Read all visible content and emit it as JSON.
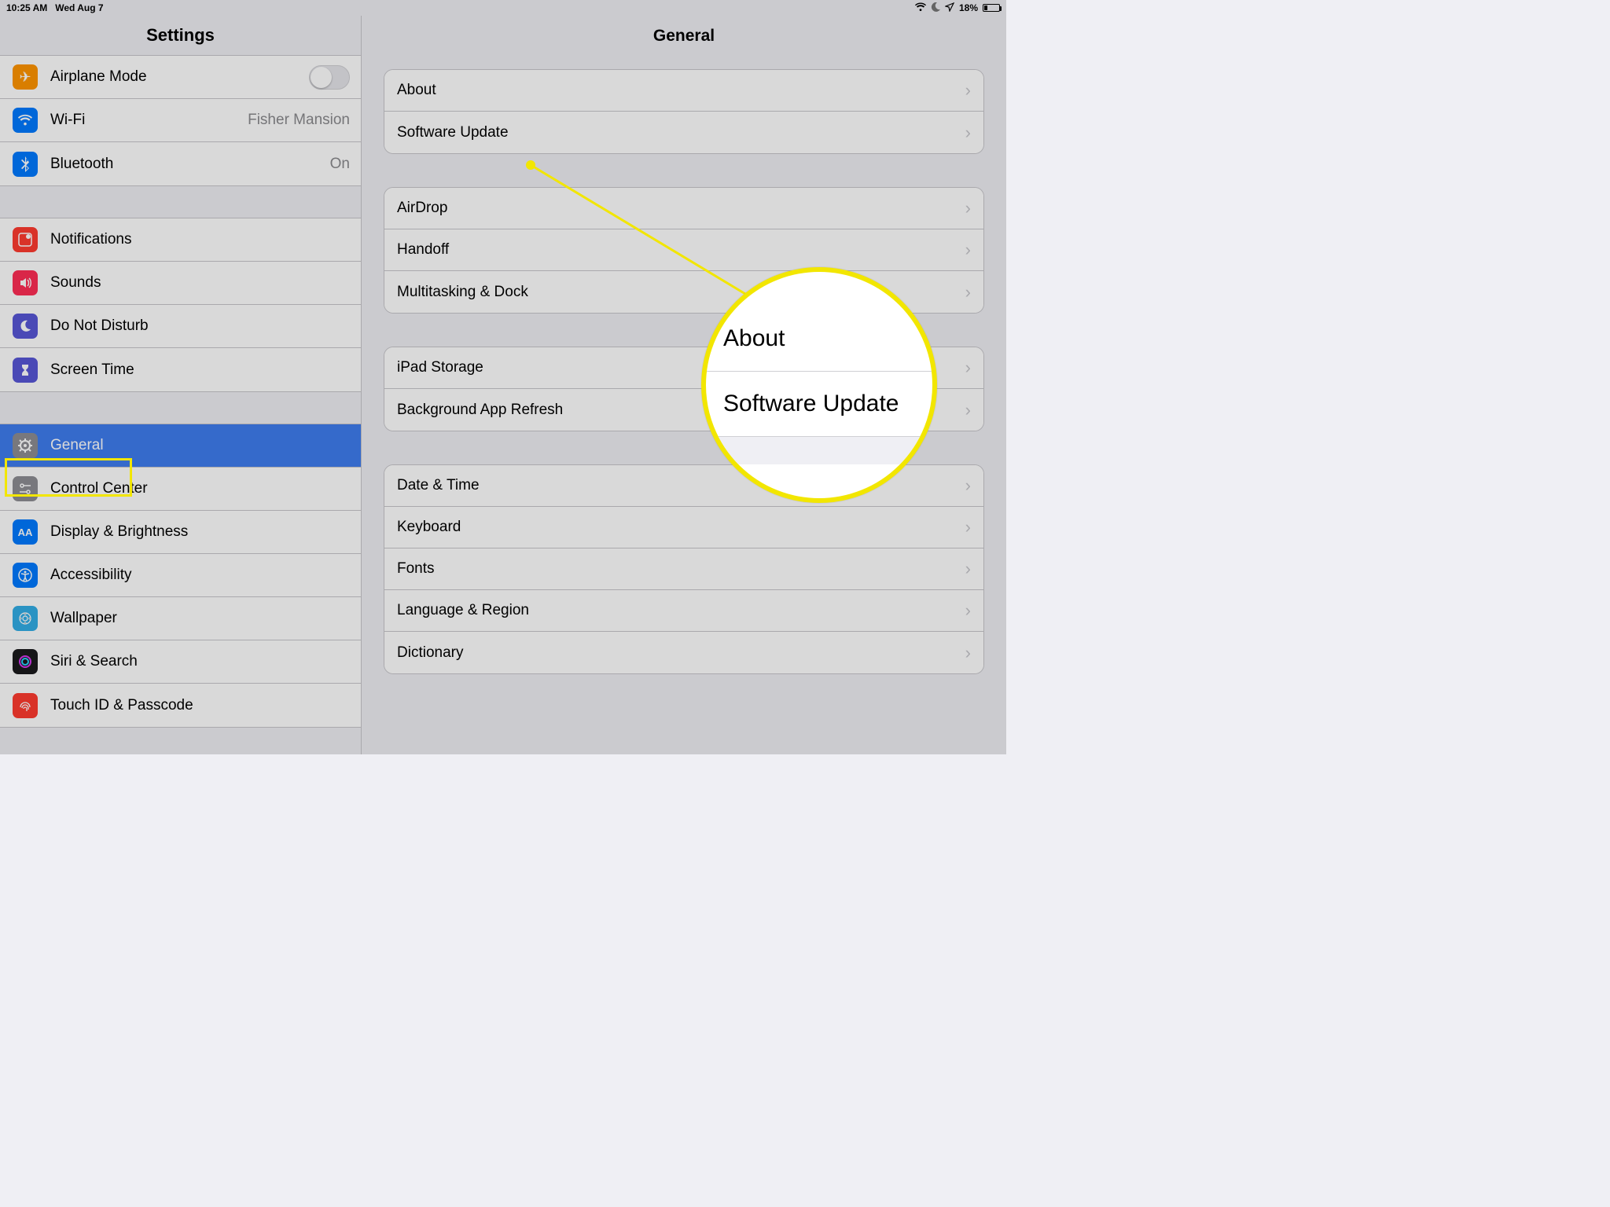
{
  "status": {
    "time": "10:25 AM",
    "date": "Wed Aug 7",
    "battery": "18%"
  },
  "sidebar": {
    "title": "Settings",
    "group1": {
      "airplane": "Airplane Mode",
      "wifi": "Wi-Fi",
      "wifi_value": "Fisher Mansion",
      "bluetooth": "Bluetooth",
      "bluetooth_value": "On"
    },
    "group2": {
      "notifications": "Notifications",
      "sounds": "Sounds",
      "dnd": "Do Not Disturb",
      "screentime": "Screen Time"
    },
    "group3": {
      "general": "General",
      "controlcenter": "Control Center",
      "display": "Display & Brightness",
      "accessibility": "Accessibility",
      "wallpaper": "Wallpaper",
      "siri": "Siri & Search",
      "touchid": "Touch ID & Passcode"
    }
  },
  "detail": {
    "title": "General",
    "g1": {
      "about": "About",
      "software": "Software Update"
    },
    "g2": {
      "airdrop": "AirDrop",
      "handoff": "Handoff",
      "multitask": "Multitasking & Dock"
    },
    "g3": {
      "storage": "iPad Storage",
      "refresh": "Background App Refresh"
    },
    "g4": {
      "datetime": "Date & Time",
      "keyboard": "Keyboard",
      "fonts": "Fonts",
      "language": "Language & Region",
      "dictionary": "Dictionary"
    }
  },
  "callout": {
    "about": "About",
    "software": "Software Update"
  }
}
